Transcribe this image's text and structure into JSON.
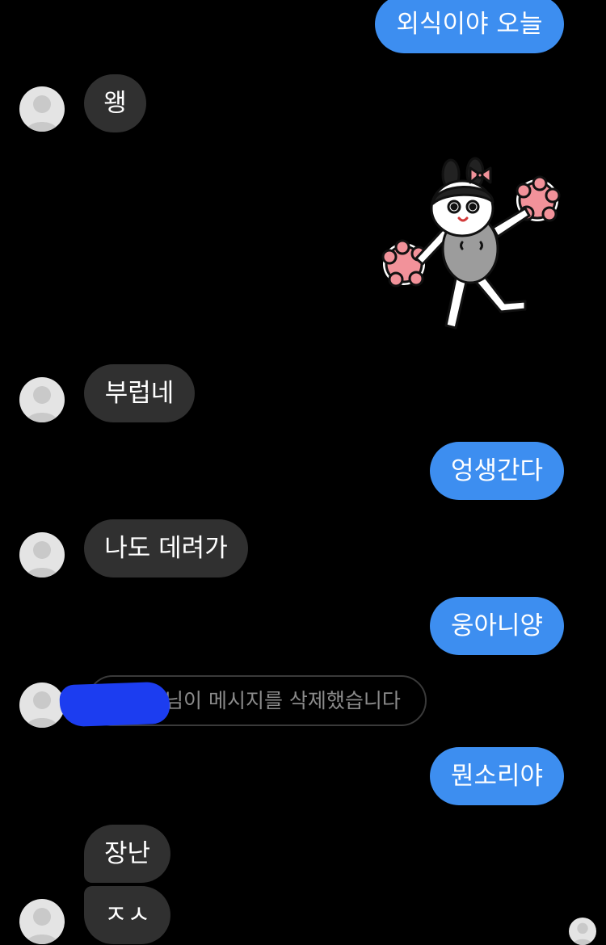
{
  "messages": {
    "m1_out": "외식이야 오늘",
    "m2_in": "왱",
    "m3_in": "부럽네",
    "m4_out": "엉생간다",
    "m5_in": "나도 데려가",
    "m6_out": "웅아니양",
    "deleted_notice": "님이 메시지를 삭제했습니다",
    "m7_out": "뭔소리야",
    "m8_in": "장난",
    "m9_in": "ㅈㅅ"
  },
  "sticker": {
    "icon": "cheerleader-bunny-sticker"
  },
  "colors": {
    "background": "#000000",
    "incoming_bubble": "#303030",
    "outgoing_bubble": "#3d8ef0",
    "redaction": "#1c3df0"
  }
}
